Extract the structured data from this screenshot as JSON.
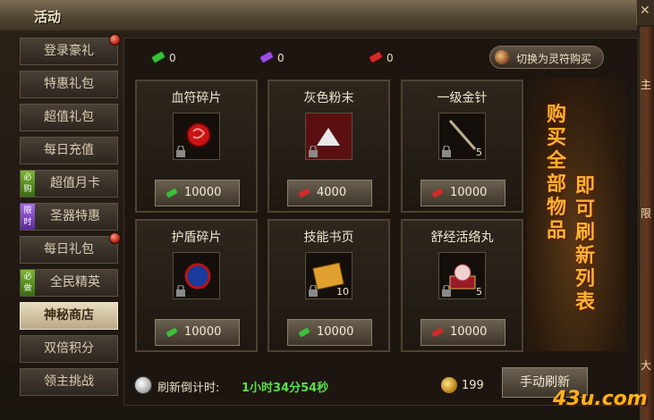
{
  "window": {
    "title": "活动",
    "close_symbol": "✕"
  },
  "right_strip": {
    "text_top": "主",
    "text_mid": "限",
    "text_bot": "大"
  },
  "sidebar": {
    "items": [
      {
        "label": "登录豪礼",
        "badge": true,
        "tag": ""
      },
      {
        "label": "特惠礼包",
        "badge": false,
        "tag": ""
      },
      {
        "label": "超值礼包",
        "badge": false,
        "tag": ""
      },
      {
        "label": "每日充值",
        "badge": false,
        "tag": ""
      },
      {
        "label": "超值月卡",
        "badge": false,
        "tag": "必购"
      },
      {
        "label": "圣器特惠",
        "badge": false,
        "tag": "限时"
      },
      {
        "label": "每日礼包",
        "badge": true,
        "tag": ""
      },
      {
        "label": "全民精英",
        "badge": false,
        "tag": "必做"
      },
      {
        "label": "神秘商店",
        "badge": false,
        "tag": "",
        "active": true
      },
      {
        "label": "双倍积分",
        "badge": false,
        "tag": ""
      },
      {
        "label": "领主挑战",
        "badge": false,
        "tag": ""
      }
    ]
  },
  "currencies": [
    {
      "icon": "green-talisman-icon",
      "value": "0",
      "color": "#3cbf3a"
    },
    {
      "icon": "purple-talisman-icon",
      "value": "0",
      "color": "#9b4fe0"
    },
    {
      "icon": "red-talisman-icon",
      "value": "0",
      "color": "#d42a2a"
    }
  ],
  "switch_button": {
    "label": "切换为灵符购买"
  },
  "items": [
    {
      "name": "血符碎片",
      "count": "",
      "price": "10000",
      "price_icon": "green-talisman-icon"
    },
    {
      "name": "灰色粉末",
      "count": "",
      "price": "4000",
      "price_icon": "red-talisman-icon"
    },
    {
      "name": "一级金针",
      "count": "5",
      "price": "10000",
      "price_icon": "red-talisman-icon"
    },
    {
      "name": "护盾碎片",
      "count": "",
      "price": "10000",
      "price_icon": "green-talisman-icon"
    },
    {
      "name": "技能书页",
      "count": "10",
      "price": "10000",
      "price_icon": "green-talisman-icon"
    },
    {
      "name": "舒经活络丸",
      "count": "5",
      "price": "10000",
      "price_icon": "red-talisman-icon"
    }
  ],
  "promo": {
    "line1": "购买全部物品",
    "line2": "即可刷新列表"
  },
  "footer": {
    "timer_label": "刷新倒计时:",
    "timer_value": "1小时34分54秒",
    "coins": "199",
    "refresh_label": "手动刷新"
  },
  "watermark": "43u.com"
}
